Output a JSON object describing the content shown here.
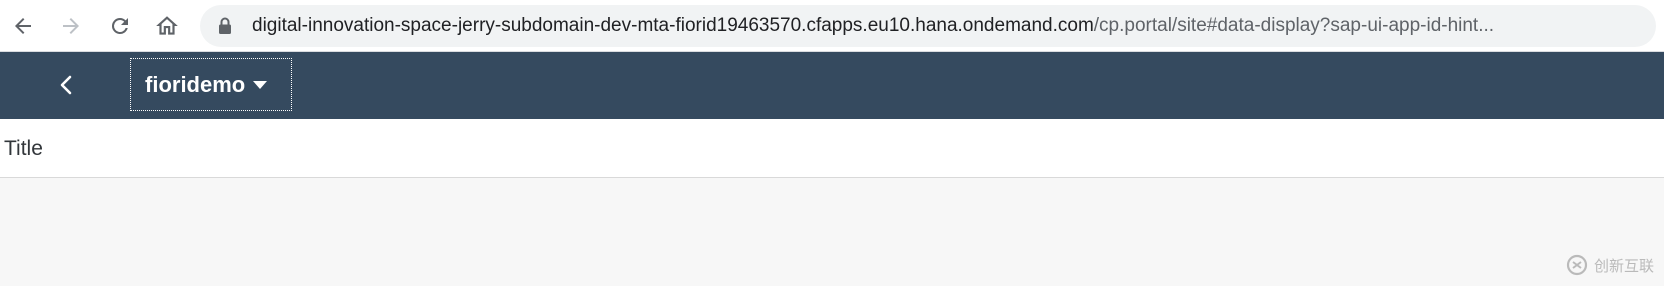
{
  "browser": {
    "url_host": "digital-innovation-space-jerry-subdomain-dev-mta-fiorid19463570.cfapps.eu10.hana.ondemand.com",
    "url_path": "/cp.portal/site#data-display?sap-ui-app-id-hint...",
    "icons": [
      "arrow-left-icon",
      "arrow-right-icon",
      "reload-icon",
      "home-icon",
      "lock-icon"
    ]
  },
  "shell": {
    "app_title": "fioridemo",
    "background_color": "#354a5f",
    "icons": [
      "chevron-left-icon",
      "caret-down-icon"
    ]
  },
  "page": {
    "title": "Title"
  },
  "watermark": {
    "text": "创新互联"
  }
}
